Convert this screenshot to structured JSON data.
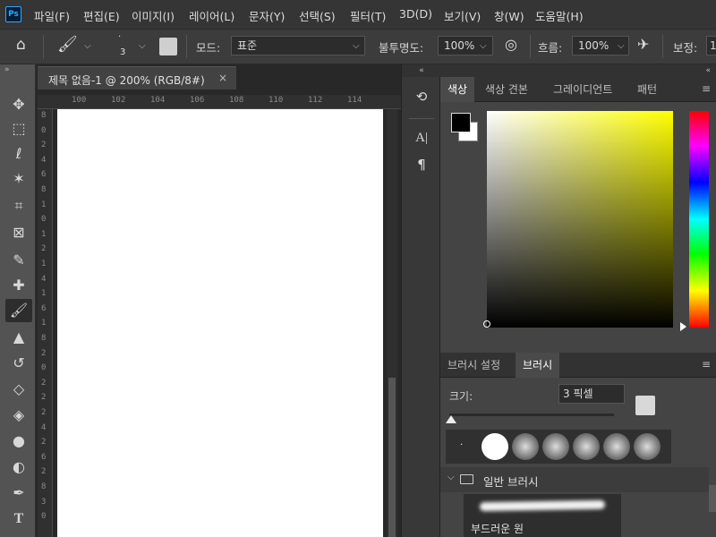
{
  "app": {
    "logo": "Ps"
  },
  "menu": [
    "파일(F)",
    "편집(E)",
    "이미지(I)",
    "레이어(L)",
    "문자(Y)",
    "선택(S)",
    "필터(T)",
    "3D(D)",
    "보기(V)",
    "창(W)",
    "도움말(H)"
  ],
  "options": {
    "brush_size": "3",
    "mode_label": "모드:",
    "mode_value": "표준",
    "opacity_label": "불투명도:",
    "opacity_value": "100%",
    "flow_label": "흐름:",
    "flow_value": "100%",
    "smoothing_label": "보정:",
    "smoothing_value": "1"
  },
  "toolbar": {
    "collapse": "»",
    "tools": [
      {
        "name": "move",
        "icon": "move-icon",
        "glyph": "✥"
      },
      {
        "name": "marquee",
        "icon": "marquee-icon",
        "glyph": "⬚"
      },
      {
        "name": "lasso",
        "icon": "lasso-icon",
        "glyph": "ℓ"
      },
      {
        "name": "magic-wand",
        "icon": "magic-wand-icon",
        "glyph": "✶"
      },
      {
        "name": "crop",
        "icon": "crop-icon",
        "glyph": "⌗"
      },
      {
        "name": "frame",
        "icon": "frame-icon",
        "glyph": "⊠"
      },
      {
        "name": "eyedropper",
        "icon": "eyedropper-icon",
        "glyph": "✎"
      },
      {
        "name": "healing",
        "icon": "healing-brush-icon",
        "glyph": "✚"
      },
      {
        "name": "brush",
        "icon": "brush-icon",
        "glyph": "🖌",
        "active": true
      },
      {
        "name": "stamp",
        "icon": "clone-stamp-icon",
        "glyph": "▲"
      },
      {
        "name": "history-brush",
        "icon": "history-brush-icon",
        "glyph": "↺"
      },
      {
        "name": "eraser",
        "icon": "eraser-icon",
        "glyph": "◇"
      },
      {
        "name": "paint-bucket",
        "icon": "paint-bucket-icon",
        "glyph": "◈"
      },
      {
        "name": "blur",
        "icon": "blur-icon",
        "glyph": "●"
      },
      {
        "name": "dodge",
        "icon": "dodge-icon",
        "glyph": "◐"
      },
      {
        "name": "pen",
        "icon": "pen-icon",
        "glyph": "✒"
      },
      {
        "name": "type",
        "icon": "type-icon",
        "glyph": "T"
      }
    ]
  },
  "document": {
    "tab_title": "제목 없음-1 @ 200% (RGB/8#)",
    "close": "×",
    "ruler_top": [
      "100",
      "102",
      "104",
      "106",
      "108",
      "110",
      "112",
      "114"
    ],
    "ruler_left": [
      "8",
      "0",
      "2",
      "4",
      "6",
      "8",
      "1",
      "0",
      "1",
      "2",
      "1",
      "4",
      "1",
      "6",
      "1",
      "8",
      "2",
      "0",
      "2",
      "2",
      "2",
      "4",
      "2",
      "6",
      "2",
      "8",
      "3",
      "0"
    ]
  },
  "mid_panel": {
    "collapse": "«",
    "icons": [
      "history-icon",
      "character-icon",
      "paragraph-icon"
    ]
  },
  "color_panel": {
    "collapse": "«",
    "menu": "≡",
    "tabs": [
      "색상",
      "색상 견본",
      "그레이디언트",
      "패턴"
    ],
    "active_tab": 0,
    "foreground": "#000000",
    "background": "#ffffff",
    "hue": "#ffff00"
  },
  "brush_panel": {
    "tabs": [
      "브러시 설정",
      "브러시"
    ],
    "active_tab": 1,
    "size_label": "크기:",
    "size_value": "3 픽셀",
    "group_label": "일반 브러시",
    "brush_name": "부드러운 원"
  }
}
